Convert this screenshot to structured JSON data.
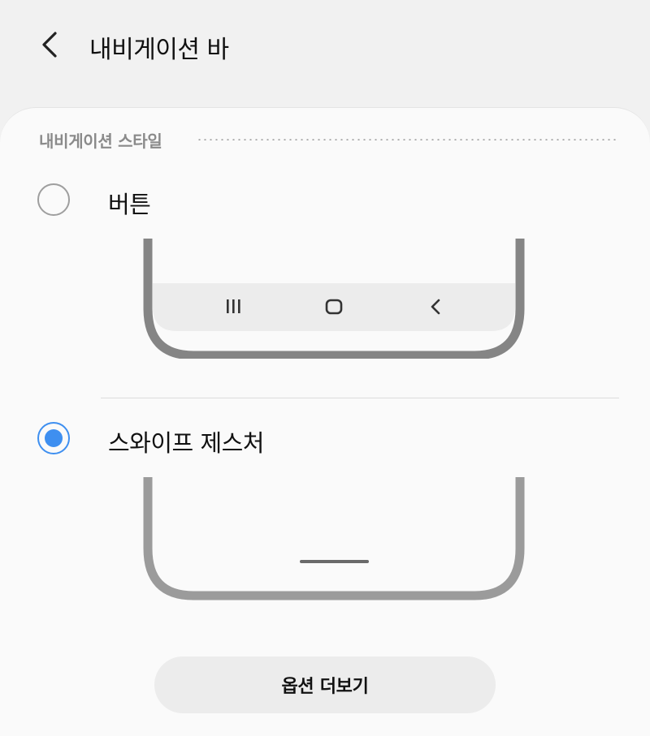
{
  "header": {
    "title": "내비게이션 바",
    "back_icon": "chevron-left-icon"
  },
  "section": {
    "title": "내비게이션 스타일"
  },
  "options": [
    {
      "label": "버튼",
      "selected": false,
      "preview": "button-navigation-preview"
    },
    {
      "label": "스와이프 제스처",
      "selected": true,
      "preview": "gesture-navigation-preview"
    }
  ],
  "more_options_label": "옵션 더보기",
  "colors": {
    "accent": "#3e8ff0",
    "background": "#f1f1f1",
    "card": "#fafafa"
  }
}
